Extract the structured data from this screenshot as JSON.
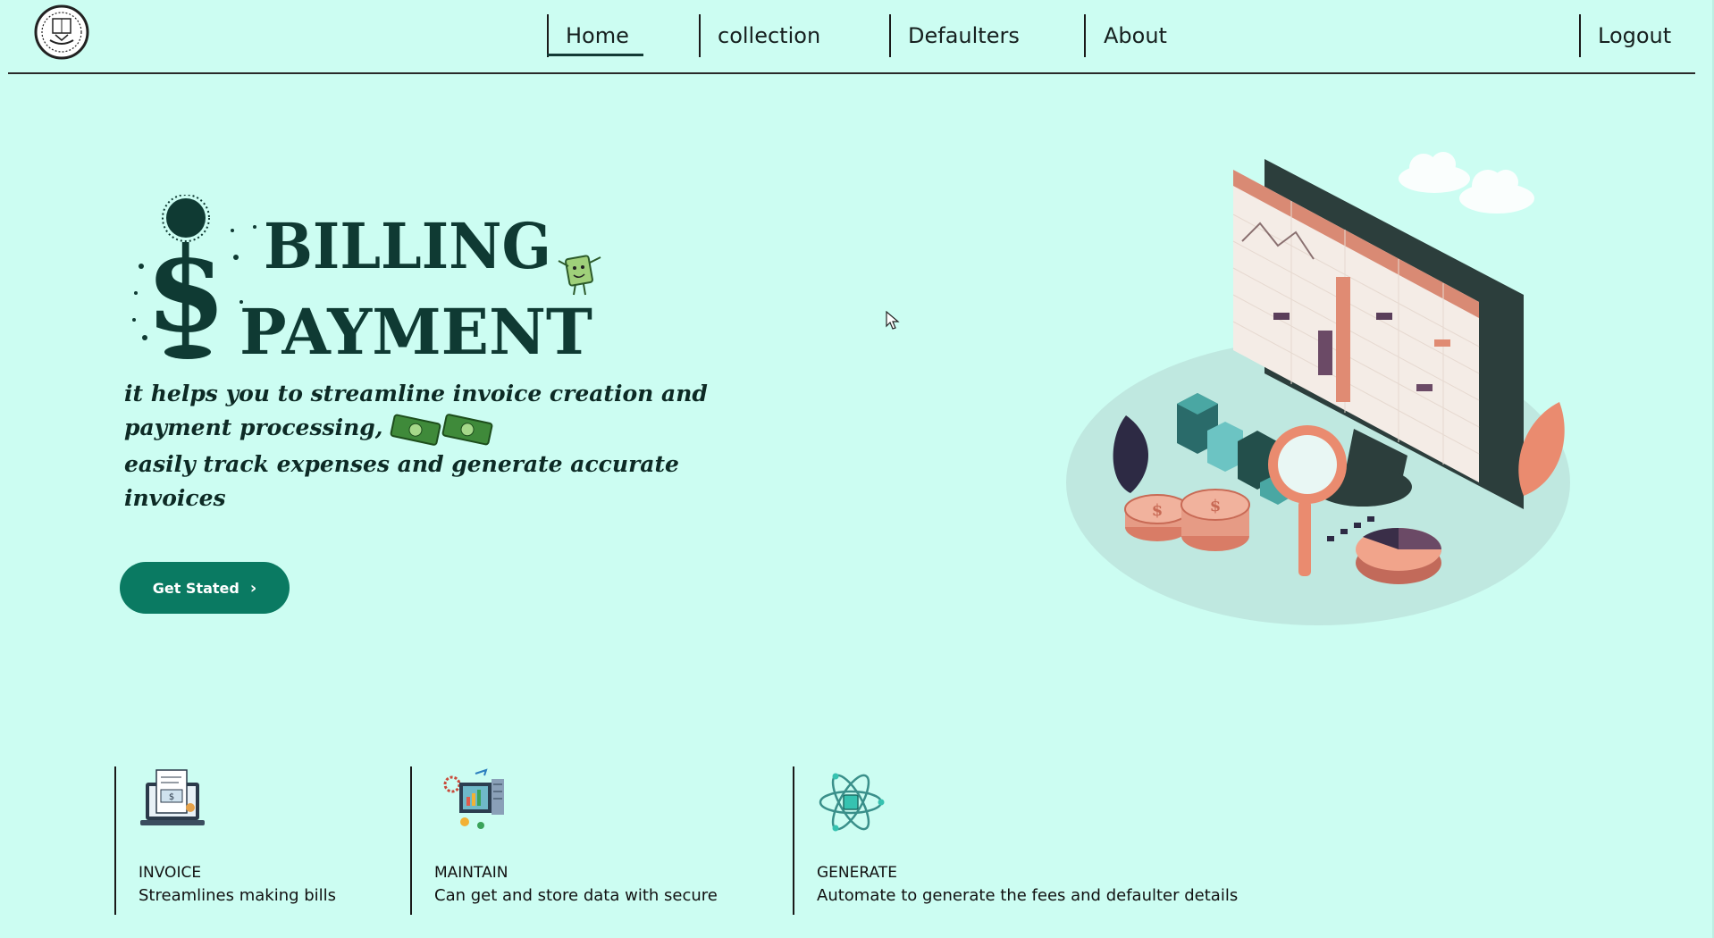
{
  "nav": {
    "logo_icon": "college-emblem-icon",
    "items": [
      {
        "label": "Home",
        "active": true
      },
      {
        "label": "collection"
      },
      {
        "label": "Defaulters"
      },
      {
        "label": "About"
      }
    ],
    "logout_label": "Logout"
  },
  "hero": {
    "brand_line1": "BILLING",
    "brand_line2": "PAYMENT",
    "tagline_lines": [
      "it helps you to streamline invoice creation and",
      "payment processing,",
      "easily track expenses and generate accurate",
      "invoices"
    ],
    "cta_label": "Get Stated",
    "illustration_icon": "billing-dashboard-illustration"
  },
  "features": [
    {
      "icon": "invoice-laptop-icon",
      "title": "INVOICE",
      "desc": "Streamlines making bills"
    },
    {
      "icon": "data-maintain-icon",
      "title": "MAINTAIN",
      "desc": "Can get and store data with secure"
    },
    {
      "icon": "atom-generate-icon",
      "title": "GENERATE",
      "desc": "Automate to generate the fees and defaulter details"
    }
  ],
  "colors": {
    "background": "#ccfdf2",
    "brand_dark": "#0f3a33",
    "button": "#0a7a62",
    "accent_salmon": "#e9907a"
  }
}
